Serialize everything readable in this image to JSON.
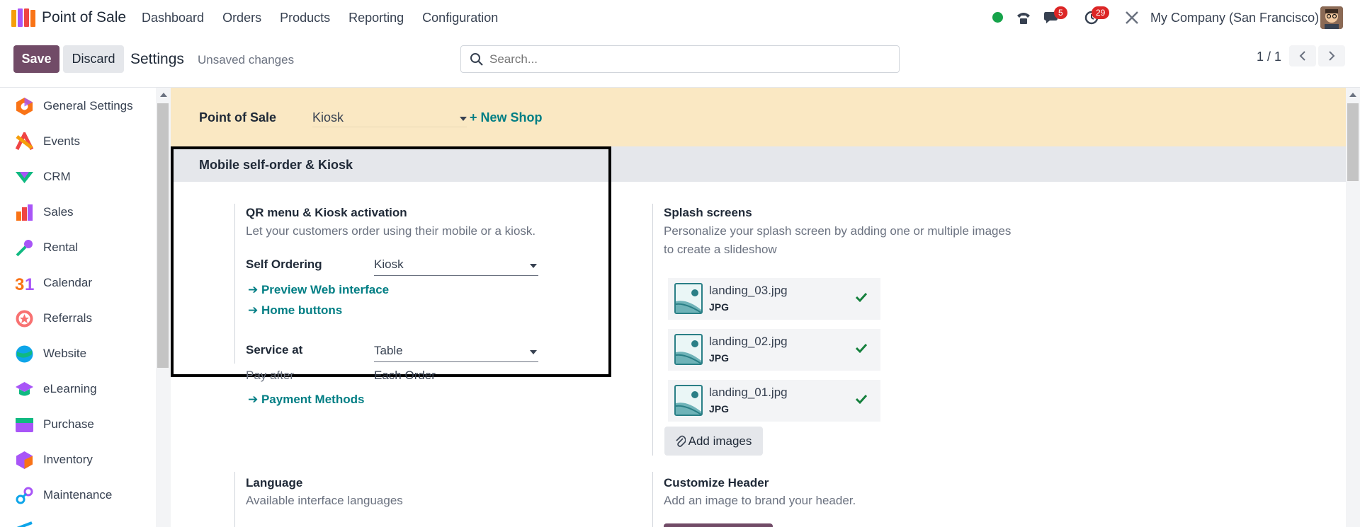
{
  "navbar": {
    "app_name": "Point of Sale",
    "menu": [
      "Dashboard",
      "Orders",
      "Products",
      "Reporting",
      "Configuration"
    ],
    "messages_count": "5",
    "activities_count": "29",
    "company": "My Company (San Francisco)"
  },
  "control_panel": {
    "save_label": "Save",
    "discard_label": "Discard",
    "title": "Settings",
    "unsaved": "Unsaved changes",
    "search_placeholder": "Search...",
    "pager": "1 / 1"
  },
  "sidebar": {
    "items": [
      {
        "label": "General Settings",
        "icon": "general-settings-icon"
      },
      {
        "label": "Events",
        "icon": "events-icon"
      },
      {
        "label": "CRM",
        "icon": "crm-icon"
      },
      {
        "label": "Sales",
        "icon": "sales-icon"
      },
      {
        "label": "Rental",
        "icon": "rental-icon"
      },
      {
        "label": "Calendar",
        "icon": "calendar-icon"
      },
      {
        "label": "Referrals",
        "icon": "referrals-icon"
      },
      {
        "label": "Website",
        "icon": "website-icon"
      },
      {
        "label": "eLearning",
        "icon": "elearning-icon"
      },
      {
        "label": "Purchase",
        "icon": "purchase-icon"
      },
      {
        "label": "Inventory",
        "icon": "inventory-icon"
      },
      {
        "label": "Maintenance",
        "icon": "maintenance-icon"
      }
    ]
  },
  "shop": {
    "label": "Point of Sale",
    "value": "Kiosk",
    "new_shop": "+ New Shop"
  },
  "section": {
    "title": "Mobile self-order & Kiosk"
  },
  "qr": {
    "title": "QR menu & Kiosk activation",
    "desc": "Let your customers order using their mobile or a kiosk.",
    "self_ordering_label": "Self Ordering",
    "self_ordering_value": "Kiosk",
    "preview_link": "Preview Web interface",
    "home_buttons_link": "Home buttons",
    "service_at_label": "Service at",
    "service_at_value": "Table",
    "pay_after_label": "Pay after",
    "pay_after_value": "Each Order",
    "payment_methods_link": "Payment Methods"
  },
  "splash": {
    "title": "Splash screens",
    "desc_line1": "Personalize your splash screen by adding one or multiple images",
    "desc_line2": "to create a slideshow",
    "files": [
      {
        "name": "landing_03.jpg",
        "ext": "JPG"
      },
      {
        "name": "landing_02.jpg",
        "ext": "JPG"
      },
      {
        "name": "landing_01.jpg",
        "ext": "JPG"
      }
    ],
    "add_images": "Add images"
  },
  "language": {
    "title": "Language",
    "desc": "Available interface languages"
  },
  "header": {
    "title": "Customize Header",
    "desc": "Add an image to brand your header."
  },
  "colors": {
    "primary": "#714b67",
    "link": "#017e84",
    "shop_bar": "#fae8c3",
    "badge": "#dc2626",
    "online": "#16a34a"
  }
}
